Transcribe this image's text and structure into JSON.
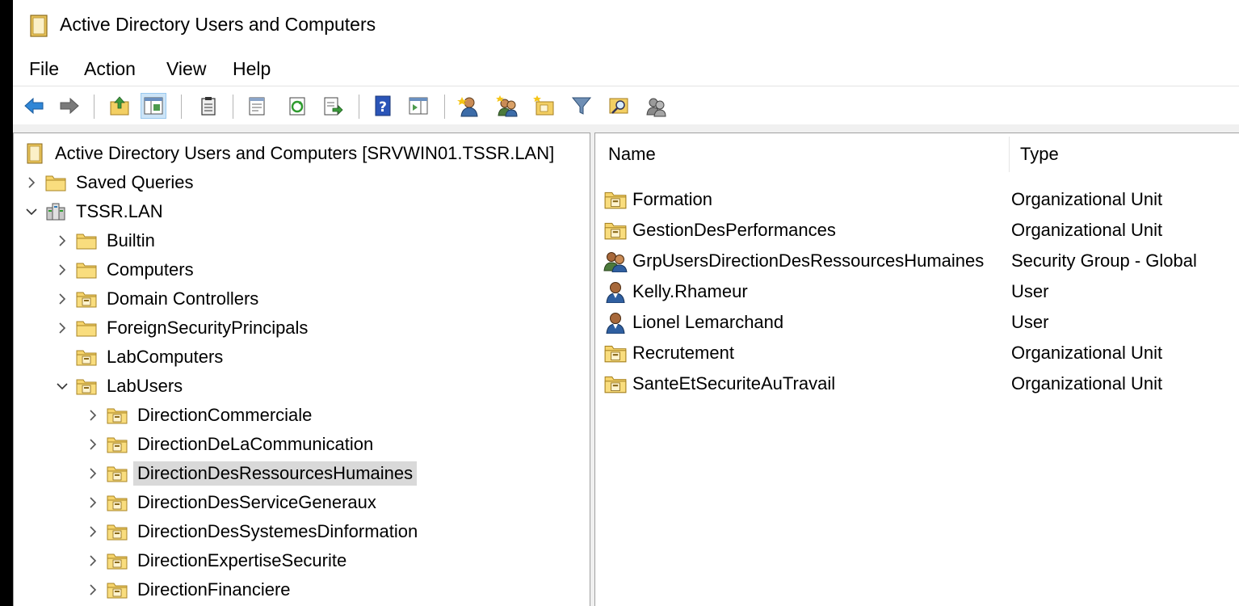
{
  "window": {
    "title": "Active Directory Users and Computers"
  },
  "menu": [
    "File",
    "Action",
    "View",
    "Help"
  ],
  "toolbar": {
    "buttons": [
      "back-icon",
      "forward-icon",
      "up-level-icon",
      "show-hide-console-tree-icon",
      "clipboard-icon",
      "properties-icon",
      "refresh-icon",
      "export-list-icon",
      "help-icon",
      "show-action-pane-icon",
      "new-user-icon",
      "new-group-icon",
      "new-ou-icon",
      "filter-icon",
      "find-icon",
      "add-to-group-icon"
    ]
  },
  "tree": {
    "root": "Active Directory Users and Computers [SRVWIN01.TSSR.LAN]",
    "items": [
      {
        "label": "Saved Queries",
        "level": 1,
        "expand": "collapsed",
        "icon": "folder-icon"
      },
      {
        "label": "TSSR.LAN",
        "level": 1,
        "expand": "expanded",
        "icon": "domain-icon"
      },
      {
        "label": "Builtin",
        "level": 2,
        "expand": "collapsed",
        "icon": "folder-icon"
      },
      {
        "label": "Computers",
        "level": 2,
        "expand": "collapsed",
        "icon": "folder-icon"
      },
      {
        "label": "Domain Controllers",
        "level": 2,
        "expand": "collapsed",
        "icon": "ou-icon"
      },
      {
        "label": "ForeignSecurityPrincipals",
        "level": 2,
        "expand": "collapsed",
        "icon": "folder-icon"
      },
      {
        "label": "LabComputers",
        "level": 2,
        "expand": "none",
        "icon": "ou-icon"
      },
      {
        "label": "LabUsers",
        "level": 2,
        "expand": "expanded",
        "icon": "ou-icon"
      },
      {
        "label": "DirectionCommerciale",
        "level": 3,
        "expand": "collapsed",
        "icon": "ou-icon"
      },
      {
        "label": "DirectionDeLaCommunication",
        "level": 3,
        "expand": "collapsed",
        "icon": "ou-icon"
      },
      {
        "label": "DirectionDesRessourcesHumaines",
        "level": 3,
        "expand": "collapsed",
        "icon": "ou-icon",
        "selected": true
      },
      {
        "label": "DirectionDesServiceGeneraux",
        "level": 3,
        "expand": "collapsed",
        "icon": "ou-icon"
      },
      {
        "label": "DirectionDesSystemesDinformation",
        "level": 3,
        "expand": "collapsed",
        "icon": "ou-icon"
      },
      {
        "label": "DirectionExpertiseSecurite",
        "level": 3,
        "expand": "collapsed",
        "icon": "ou-icon"
      },
      {
        "label": "DirectionFinanciere",
        "level": 3,
        "expand": "collapsed",
        "icon": "ou-icon"
      }
    ]
  },
  "list": {
    "columns": {
      "name": "Name",
      "type": "Type"
    },
    "rows": [
      {
        "name": "Formation",
        "type": "Organizational Unit",
        "icon": "ou-icon"
      },
      {
        "name": "GestionDesPerformances",
        "type": "Organizational Unit",
        "icon": "ou-icon"
      },
      {
        "name": "GrpUsersDirectionDesRessourcesHumaines",
        "type": "Security Group - Global",
        "icon": "group-icon"
      },
      {
        "name": "Kelly.Rhameur",
        "type": "User",
        "icon": "user-icon"
      },
      {
        "name": "Lionel Lemarchand",
        "type": "User",
        "icon": "user-icon"
      },
      {
        "name": "Recrutement",
        "type": "Organizational Unit",
        "icon": "ou-icon"
      },
      {
        "name": "SanteEtSecuriteAuTravail",
        "type": "Organizational Unit",
        "icon": "ou-icon"
      }
    ]
  }
}
